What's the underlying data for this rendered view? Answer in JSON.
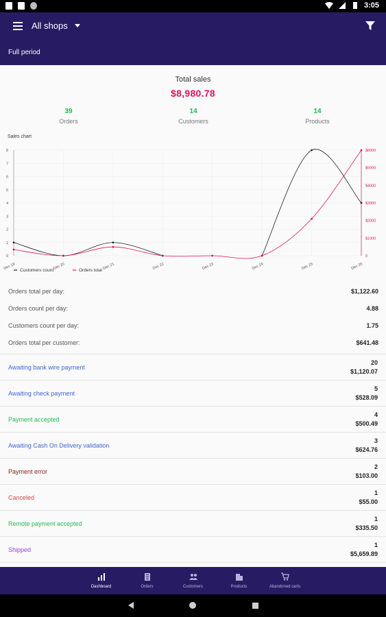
{
  "status_bar": {
    "time": "3:05"
  },
  "header": {
    "shop_label": "All shops",
    "period": "Full period"
  },
  "summary": {
    "total_label": "Total sales",
    "total_value": "$8,980.78",
    "stats": [
      {
        "value": "39",
        "label": "Orders"
      },
      {
        "value": "14",
        "label": "Customers"
      },
      {
        "value": "14",
        "label": "Products"
      }
    ]
  },
  "chart_data": {
    "type": "line",
    "title": "Sales chart",
    "categories": [
      "Dec 19",
      "Dec 20",
      "Dec 21",
      "Dec 22",
      "Dec 23",
      "Dec 24",
      "Dec 25",
      "Dec 26"
    ],
    "left_axis": {
      "ticks": [
        "0",
        "1",
        "2",
        "3",
        "4",
        "5",
        "6",
        "7",
        "8"
      ],
      "ylim": [
        0,
        8
      ]
    },
    "right_axis": {
      "ticks": [
        "0",
        "$1000",
        "$2000",
        "$3000",
        "$4000",
        "$5000",
        "$6000"
      ],
      "ylim": [
        0,
        6000
      ]
    },
    "series": [
      {
        "name": "Customers count",
        "axis": "left",
        "color": "#222222",
        "values": [
          1,
          0,
          1,
          0,
          null,
          0,
          8,
          4
        ]
      },
      {
        "name": "Orders total",
        "axis": "right",
        "color": "#e0115f",
        "values": [
          350,
          0,
          500,
          0,
          0,
          0,
          2100,
          6000
        ]
      }
    ],
    "legend_position": "bottom-left",
    "grid": true
  },
  "metrics": [
    {
      "label": "Orders total per day:",
      "value": "$1,122.60"
    },
    {
      "label": "Orders count per day:",
      "value": "4.88"
    },
    {
      "label": "Customers count per day:",
      "value": "1.75"
    },
    {
      "label": "Orders total per customer:",
      "value": "$641.48"
    }
  ],
  "order_statuses": [
    {
      "label": "Awaiting bank wire payment",
      "count": "20",
      "amount": "$1,120.07",
      "color": "#3f64d6"
    },
    {
      "label": "Awaiting check payment",
      "count": "5",
      "amount": "$528.09",
      "color": "#3f64d6"
    },
    {
      "label": "Payment accepted",
      "count": "4",
      "amount": "$500.49",
      "color": "#1fb950"
    },
    {
      "label": "Awaiting Cash On Delivery validation",
      "count": "3",
      "amount": "$624.76",
      "color": "#3f64d6"
    },
    {
      "label": "Payment error",
      "count": "2",
      "amount": "$103.00",
      "color": "#8b1a1a"
    },
    {
      "label": "Canceled",
      "count": "1",
      "amount": "$55.00",
      "color": "#e04040"
    },
    {
      "label": "Remote payment accepted",
      "count": "1",
      "amount": "$335.50",
      "color": "#1fb950"
    },
    {
      "label": "Shipped",
      "count": "1",
      "amount": "$5,659.89",
      "color": "#8b45d6"
    }
  ],
  "bottom_nav": [
    {
      "label": "Dashboard",
      "icon": "bar-chart-icon",
      "active": true
    },
    {
      "label": "Orders",
      "icon": "clipboard-icon",
      "active": false
    },
    {
      "label": "Customers",
      "icon": "people-icon",
      "active": false
    },
    {
      "label": "Products",
      "icon": "building-icon",
      "active": false
    },
    {
      "label": "Abandoned carts",
      "icon": "cart-icon",
      "active": false
    }
  ]
}
